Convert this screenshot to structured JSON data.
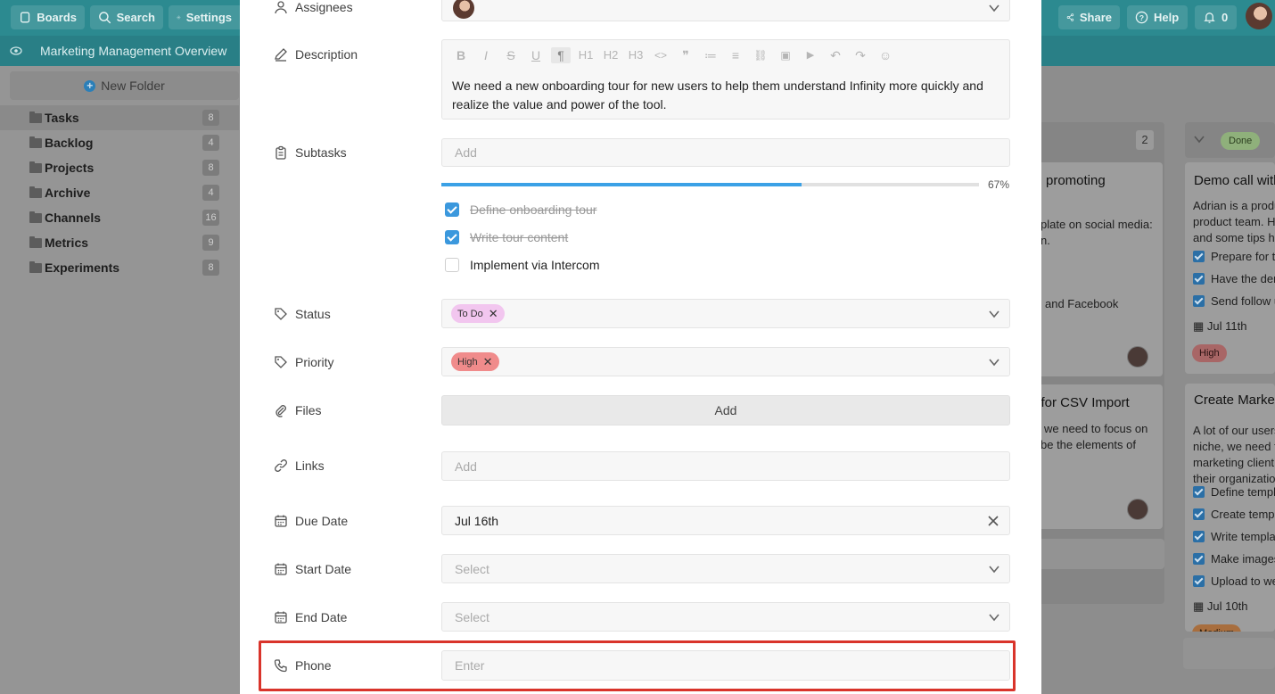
{
  "topbar": {
    "boards_label": "Boards",
    "search_label": "Search",
    "settings_label": "Settings",
    "share_label": "Share",
    "help_label": "Help",
    "notifications_count": "0"
  },
  "board_title": "Marketing Management Overview",
  "sidebar": {
    "new_folder_label": "New Folder",
    "folders": [
      {
        "name": "Tasks",
        "count": "8"
      },
      {
        "name": "Backlog",
        "count": "4"
      },
      {
        "name": "Projects",
        "count": "8"
      },
      {
        "name": "Archive",
        "count": "4"
      },
      {
        "name": "Channels",
        "count": "16"
      },
      {
        "name": "Metrics",
        "count": "9"
      },
      {
        "name": "Experiments",
        "count": "8"
      }
    ]
  },
  "board": {
    "column_count": "2",
    "done_label": "Done",
    "card1": {
      "title": "promoting",
      "line1": "plate on social media:",
      "line2": "n.",
      "line3": "and Facebook"
    },
    "card2": {
      "title": "n for CSV Import",
      "line1": "we need to focus on",
      "line2": "be the elements of"
    },
    "done_card1": {
      "title": "Demo call with",
      "lines": [
        "Adrian is a produ",
        "product team. H",
        "and some tips ho"
      ],
      "checks": [
        "Prepare for t",
        "Have the der",
        "Send follow u"
      ],
      "date": "Jul 11th",
      "priority": "High"
    },
    "done_card2": {
      "title": "Create Market",
      "lines": [
        "A lot of our users",
        "niche, we need t",
        "marketing client",
        "their organizatio"
      ],
      "checks": [
        "Define templ",
        "Create templ",
        "Write templa",
        "Make images",
        "Upload to we"
      ],
      "date": "Jul 10th",
      "priority": "Medium"
    }
  },
  "modal": {
    "assignees_label": "Assignees",
    "description_label": "Description",
    "description_text": "We need a new onboarding tour for new users to help them understand Infinity more quickly and realize the value and power of the tool.",
    "toolbar": [
      "B",
      "I",
      "S",
      "U",
      "¶",
      "H1",
      "H2",
      "H3",
      "<>",
      "❞",
      "≔",
      "≡",
      "⛓",
      "▣",
      "▶",
      "↶",
      "↷",
      "☺"
    ],
    "subtasks_label": "Subtasks",
    "subtasks_placeholder": "Add",
    "subtasks_progress": 0.67,
    "subtasks_progress_text": "67%",
    "subtasks": [
      {
        "text": "Define onboarding tour",
        "done": true
      },
      {
        "text": "Write tour content",
        "done": true
      },
      {
        "text": "Implement via Intercom",
        "done": false
      }
    ],
    "status_label": "Status",
    "status_value": "To Do",
    "priority_label": "Priority",
    "priority_value": "High",
    "files_label": "Files",
    "files_button": "Add",
    "links_label": "Links",
    "links_placeholder": "Add",
    "due_date_label": "Due Date",
    "due_date_value": "Jul 16th",
    "start_date_label": "Start Date",
    "start_date_placeholder": "Select",
    "end_date_label": "End Date",
    "end_date_placeholder": "Select",
    "phone_label": "Phone",
    "phone_placeholder": "Enter"
  },
  "colors": {
    "topbar": "#2c8a90",
    "todo_tag": "#f2c6ef",
    "high_tag": "#f08b8b",
    "progress": "#3ba1e6",
    "highlight": "#d9342b"
  }
}
